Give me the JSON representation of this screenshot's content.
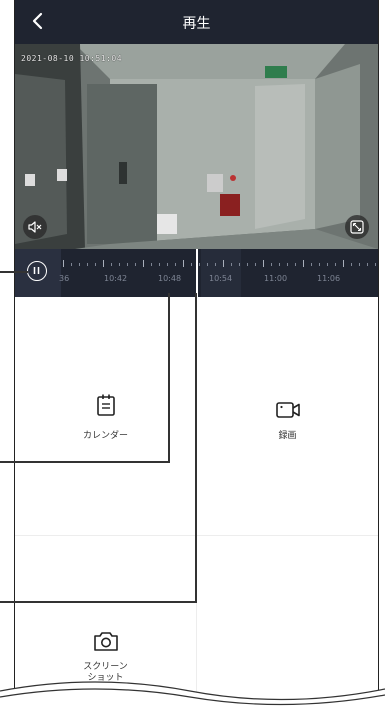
{
  "header": {
    "title": "再生"
  },
  "video": {
    "timestamp": "2021-08-10 10:51:04"
  },
  "timeline": {
    "labels": [
      "36",
      "10:42",
      "10:48",
      "10:54",
      "11:00",
      "11:06"
    ]
  },
  "actions": {
    "calendar": "カレンダー",
    "record": "録画",
    "screenshot_line1": "スクリーン",
    "screenshot_line2": "ショット"
  }
}
